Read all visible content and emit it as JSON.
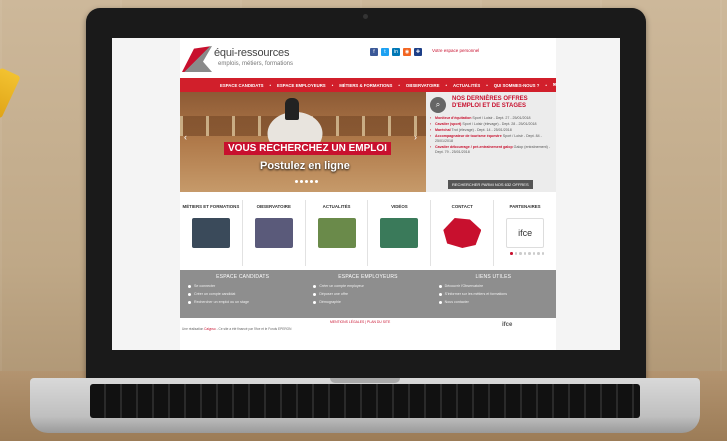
{
  "site": {
    "logo_name": "équi-ressources",
    "tagline": "emplois, métiers, formations",
    "socials": [
      {
        "icon": "facebook-icon",
        "glyph": "f",
        "color": "#3b5998"
      },
      {
        "icon": "twitter-icon",
        "glyph": "t",
        "color": "#1da1f2"
      },
      {
        "icon": "linkedin-icon",
        "glyph": "in",
        "color": "#0077b5"
      },
      {
        "icon": "rss-icon",
        "glyph": "◉",
        "color": "#f26522"
      },
      {
        "icon": "uk-flag-icon",
        "glyph": "✚",
        "color": "#1d3f87"
      }
    ],
    "personal_space": "Votre espace personnel"
  },
  "nav": {
    "items": [
      "ESPACE CANDIDATS",
      "ESPACE EMPLOYEURS",
      "MÉTIERS & FORMATIONS",
      "OBSERVATOIRE",
      "ACTUALITÉS",
      "QUI SOMMES-NOUS ?"
    ]
  },
  "hero": {
    "title": "VOUS RECHERCHEZ UN EMPLOI",
    "subtitle": "Postulez en ligne"
  },
  "offers": {
    "title_line1": "NOS DERNIÈRES OFFRES",
    "title_line2": "D'EMPLOI ET DE STAGES",
    "items": [
      {
        "title": "Moniteur d'équitation",
        "detail": "Sport / Loisir - Dept. 27 - 25/01/2018"
      },
      {
        "title": "Cavalier (sport)",
        "detail": "Sport / Loisir (élevage) - Dept. 28 - 25/01/2018"
      },
      {
        "title": "Maréchal",
        "detail": "Trot (élevage) - Dept. 14 - 25/01/2018"
      },
      {
        "title": "Accompagnateur de tourisme équestre",
        "detail": "Sport / Loisir - Dept. 84 - 25/01/2018"
      },
      {
        "title": "Cavalier débourrage / pré-entraînement galop",
        "detail": "Galop (entraînement) - Dept. 79 - 25/01/2018"
      }
    ],
    "button": "RECHERCHER PARMI NOS 632 OFFRES"
  },
  "tiles": [
    {
      "label": "MÉTIERS ET FORMATIONS",
      "color": "#3a4a5a"
    },
    {
      "label": "OBSERVATOIRE",
      "color": "#5a5a7a"
    },
    {
      "label": "ACTUALITÉS",
      "color": "#6a8a4a"
    },
    {
      "label": "VIDÉOS",
      "color": "#3a7a5a"
    },
    {
      "label": "CONTACT",
      "color": "#c8102e"
    },
    {
      "label": "PARTENAIRES",
      "color": "#ffffff"
    }
  ],
  "partner_logo": "ifce",
  "footer": {
    "columns": [
      {
        "title": "ESPACE CANDIDATS",
        "links": [
          "Se connecter",
          "Créer un compte candidat",
          "Rechercher un emploi ou un stage"
        ]
      },
      {
        "title": "ESPACE EMPLOYEURS",
        "links": [
          "Créer un compte employeur",
          "Déposer une offre",
          "Démographie"
        ]
      },
      {
        "title": "LIENS UTILES",
        "links": [
          "Découvrir l'Observatoire",
          "S'informer sur les métiers et formations",
          "Nous contacter"
        ]
      }
    ],
    "legal": "MENTIONS LÉGALES  |  PLAN DU SITE",
    "credit_prefix": "Une réalisation",
    "credit_agency": "Calypso",
    "credit_suffix": "- Ce site a été financé par l'Ifce et le Fonds EPERON"
  }
}
